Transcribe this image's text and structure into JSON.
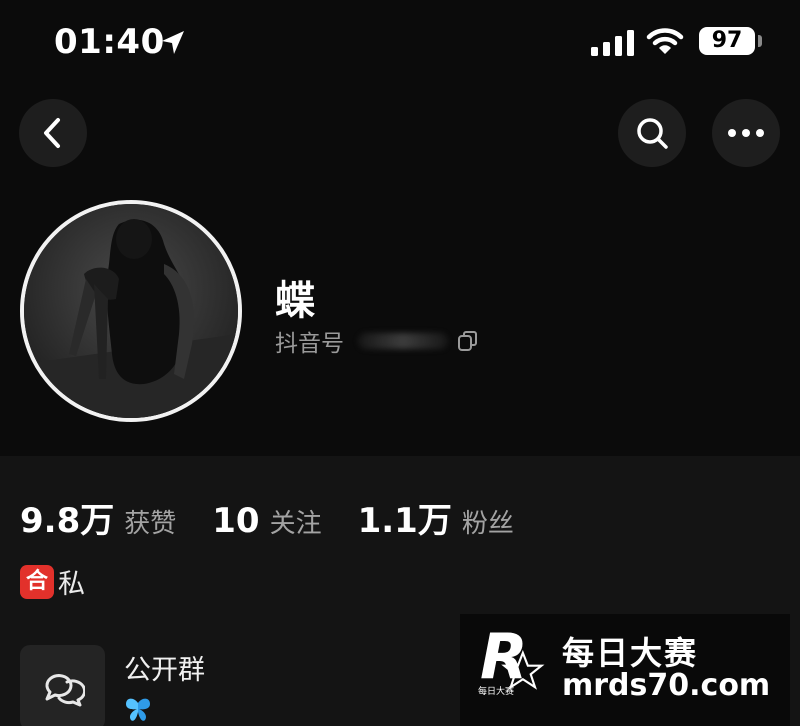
{
  "status_bar": {
    "time": "01:40",
    "battery": "97"
  },
  "profile": {
    "nickname": "蝶",
    "douyin_id_label": "抖音号"
  },
  "stats": [
    {
      "value": "9.8万",
      "label": "获赞"
    },
    {
      "value": "10",
      "label": "关注"
    },
    {
      "value": "1.1万",
      "label": "粉丝"
    }
  ],
  "tag": {
    "badge": "合",
    "text": "私"
  },
  "group": {
    "title": "公开群"
  },
  "watermark": {
    "logo_letter": "R",
    "logo_small": "每日大赛",
    "name": "每日大赛",
    "url": "mrds70.com"
  },
  "colors": {
    "background": "#0b0b0b",
    "panel": "#141414",
    "badge_red": "#e2312b",
    "muted_text": "#a3a3a3"
  }
}
